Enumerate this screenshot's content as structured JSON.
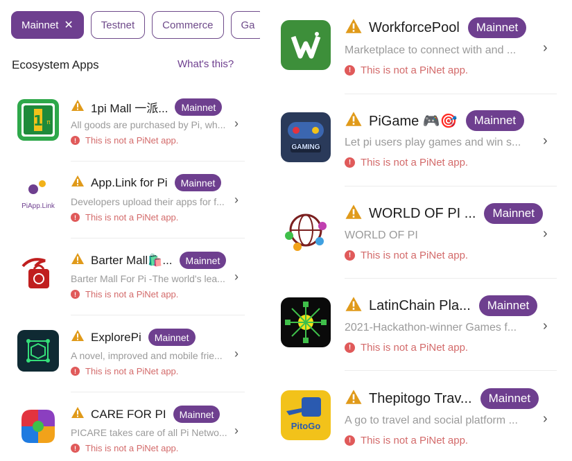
{
  "colors": {
    "accent": "#6e3f8f",
    "warning": "#e09a1a",
    "error": "#e05a5a",
    "notice_text": "#d36a6a",
    "muted": "#9a9a9a"
  },
  "filters": [
    {
      "label": "Mainnet",
      "active": true,
      "close_icon": "close-icon"
    },
    {
      "label": "Testnet",
      "active": false
    },
    {
      "label": "Commerce",
      "active": false
    },
    {
      "label": "Ga",
      "active": false
    }
  ],
  "section": {
    "title": "Ecosystem Apps",
    "link": "What's this?"
  },
  "left_apps": [
    {
      "name": "1pi Mall 一派...",
      "badge": "Mainnet",
      "description": "All goods are purchased by Pi, wh...",
      "notice": "This is not a PiNet app.",
      "icon": "1pi-mall-icon"
    },
    {
      "name": "App.Link for Pi",
      "badge": "Mainnet",
      "description": "Developers upload their apps for f...",
      "notice": "This is not a PiNet app.",
      "icon": "applink-icon",
      "icon_text": "PiApp.Link"
    },
    {
      "name": "Barter Mall🛍️...",
      "badge": "Mainnet",
      "description": "Barter Mall For Pi -The world's lea...",
      "notice": "This is not a PiNet app.",
      "icon": "barter-mall-icon"
    },
    {
      "name": "ExplorePi",
      "badge": "Mainnet",
      "description": "A novel, improved and mobile frie...",
      "notice": "This is not a PiNet app.",
      "icon": "explorepi-icon"
    },
    {
      "name": "CARE FOR PI",
      "badge": "Mainnet",
      "description": "PICARE takes care of all Pi Netwo...",
      "notice": "This is not a PiNet app.",
      "icon": "care-for-pi-icon"
    }
  ],
  "right_apps": [
    {
      "name": "WorkforcePool",
      "badge": "Mainnet",
      "description": "Marketplace to connect with and ...",
      "notice": "This is not a PiNet app.",
      "icon": "workforcepool-icon"
    },
    {
      "name": "PiGame 🎮🎯",
      "badge": "Mainnet",
      "description": "Let pi users play games and win s...",
      "notice": "This is not a PiNet app.",
      "icon": "pigame-icon",
      "icon_text": "GAMING"
    },
    {
      "name": "WORLD OF PI ...",
      "badge": "Mainnet",
      "description": "WORLD OF PI",
      "notice": "This is not a PiNet app.",
      "icon": "world-of-pi-icon"
    },
    {
      "name": "LatinChain Pla...",
      "badge": "Mainnet",
      "description": "2021-Hackathon-winner Games f...",
      "notice": "This is not a PiNet app.",
      "icon": "latinchain-icon"
    },
    {
      "name": "Thepitogo Trav...",
      "badge": "Mainnet",
      "description": "A go to travel and social platform ...",
      "notice": "This is not a PiNet app.",
      "icon": "pitogo-icon",
      "icon_text": "PitoGo"
    }
  ]
}
